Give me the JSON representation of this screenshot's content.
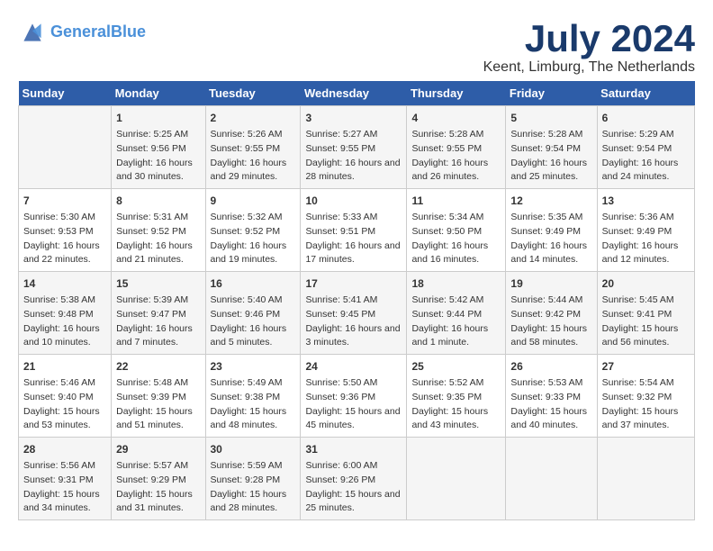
{
  "header": {
    "logo_line1": "General",
    "logo_line2": "Blue",
    "month": "July 2024",
    "location": "Keent, Limburg, The Netherlands"
  },
  "weekdays": [
    "Sunday",
    "Monday",
    "Tuesday",
    "Wednesday",
    "Thursday",
    "Friday",
    "Saturday"
  ],
  "weeks": [
    [
      {
        "day": "",
        "sunrise": "",
        "sunset": "",
        "daylight": ""
      },
      {
        "day": "1",
        "sunrise": "Sunrise: 5:25 AM",
        "sunset": "Sunset: 9:56 PM",
        "daylight": "Daylight: 16 hours and 30 minutes."
      },
      {
        "day": "2",
        "sunrise": "Sunrise: 5:26 AM",
        "sunset": "Sunset: 9:55 PM",
        "daylight": "Daylight: 16 hours and 29 minutes."
      },
      {
        "day": "3",
        "sunrise": "Sunrise: 5:27 AM",
        "sunset": "Sunset: 9:55 PM",
        "daylight": "Daylight: 16 hours and 28 minutes."
      },
      {
        "day": "4",
        "sunrise": "Sunrise: 5:28 AM",
        "sunset": "Sunset: 9:55 PM",
        "daylight": "Daylight: 16 hours and 26 minutes."
      },
      {
        "day": "5",
        "sunrise": "Sunrise: 5:28 AM",
        "sunset": "Sunset: 9:54 PM",
        "daylight": "Daylight: 16 hours and 25 minutes."
      },
      {
        "day": "6",
        "sunrise": "Sunrise: 5:29 AM",
        "sunset": "Sunset: 9:54 PM",
        "daylight": "Daylight: 16 hours and 24 minutes."
      }
    ],
    [
      {
        "day": "7",
        "sunrise": "Sunrise: 5:30 AM",
        "sunset": "Sunset: 9:53 PM",
        "daylight": "Daylight: 16 hours and 22 minutes."
      },
      {
        "day": "8",
        "sunrise": "Sunrise: 5:31 AM",
        "sunset": "Sunset: 9:52 PM",
        "daylight": "Daylight: 16 hours and 21 minutes."
      },
      {
        "day": "9",
        "sunrise": "Sunrise: 5:32 AM",
        "sunset": "Sunset: 9:52 PM",
        "daylight": "Daylight: 16 hours and 19 minutes."
      },
      {
        "day": "10",
        "sunrise": "Sunrise: 5:33 AM",
        "sunset": "Sunset: 9:51 PM",
        "daylight": "Daylight: 16 hours and 17 minutes."
      },
      {
        "day": "11",
        "sunrise": "Sunrise: 5:34 AM",
        "sunset": "Sunset: 9:50 PM",
        "daylight": "Daylight: 16 hours and 16 minutes."
      },
      {
        "day": "12",
        "sunrise": "Sunrise: 5:35 AM",
        "sunset": "Sunset: 9:49 PM",
        "daylight": "Daylight: 16 hours and 14 minutes."
      },
      {
        "day": "13",
        "sunrise": "Sunrise: 5:36 AM",
        "sunset": "Sunset: 9:49 PM",
        "daylight": "Daylight: 16 hours and 12 minutes."
      }
    ],
    [
      {
        "day": "14",
        "sunrise": "Sunrise: 5:38 AM",
        "sunset": "Sunset: 9:48 PM",
        "daylight": "Daylight: 16 hours and 10 minutes."
      },
      {
        "day": "15",
        "sunrise": "Sunrise: 5:39 AM",
        "sunset": "Sunset: 9:47 PM",
        "daylight": "Daylight: 16 hours and 7 minutes."
      },
      {
        "day": "16",
        "sunrise": "Sunrise: 5:40 AM",
        "sunset": "Sunset: 9:46 PM",
        "daylight": "Daylight: 16 hours and 5 minutes."
      },
      {
        "day": "17",
        "sunrise": "Sunrise: 5:41 AM",
        "sunset": "Sunset: 9:45 PM",
        "daylight": "Daylight: 16 hours and 3 minutes."
      },
      {
        "day": "18",
        "sunrise": "Sunrise: 5:42 AM",
        "sunset": "Sunset: 9:44 PM",
        "daylight": "Daylight: 16 hours and 1 minute."
      },
      {
        "day": "19",
        "sunrise": "Sunrise: 5:44 AM",
        "sunset": "Sunset: 9:42 PM",
        "daylight": "Daylight: 15 hours and 58 minutes."
      },
      {
        "day": "20",
        "sunrise": "Sunrise: 5:45 AM",
        "sunset": "Sunset: 9:41 PM",
        "daylight": "Daylight: 15 hours and 56 minutes."
      }
    ],
    [
      {
        "day": "21",
        "sunrise": "Sunrise: 5:46 AM",
        "sunset": "Sunset: 9:40 PM",
        "daylight": "Daylight: 15 hours and 53 minutes."
      },
      {
        "day": "22",
        "sunrise": "Sunrise: 5:48 AM",
        "sunset": "Sunset: 9:39 PM",
        "daylight": "Daylight: 15 hours and 51 minutes."
      },
      {
        "day": "23",
        "sunrise": "Sunrise: 5:49 AM",
        "sunset": "Sunset: 9:38 PM",
        "daylight": "Daylight: 15 hours and 48 minutes."
      },
      {
        "day": "24",
        "sunrise": "Sunrise: 5:50 AM",
        "sunset": "Sunset: 9:36 PM",
        "daylight": "Daylight: 15 hours and 45 minutes."
      },
      {
        "day": "25",
        "sunrise": "Sunrise: 5:52 AM",
        "sunset": "Sunset: 9:35 PM",
        "daylight": "Daylight: 15 hours and 43 minutes."
      },
      {
        "day": "26",
        "sunrise": "Sunrise: 5:53 AM",
        "sunset": "Sunset: 9:33 PM",
        "daylight": "Daylight: 15 hours and 40 minutes."
      },
      {
        "day": "27",
        "sunrise": "Sunrise: 5:54 AM",
        "sunset": "Sunset: 9:32 PM",
        "daylight": "Daylight: 15 hours and 37 minutes."
      }
    ],
    [
      {
        "day": "28",
        "sunrise": "Sunrise: 5:56 AM",
        "sunset": "Sunset: 9:31 PM",
        "daylight": "Daylight: 15 hours and 34 minutes."
      },
      {
        "day": "29",
        "sunrise": "Sunrise: 5:57 AM",
        "sunset": "Sunset: 9:29 PM",
        "daylight": "Daylight: 15 hours and 31 minutes."
      },
      {
        "day": "30",
        "sunrise": "Sunrise: 5:59 AM",
        "sunset": "Sunset: 9:28 PM",
        "daylight": "Daylight: 15 hours and 28 minutes."
      },
      {
        "day": "31",
        "sunrise": "Sunrise: 6:00 AM",
        "sunset": "Sunset: 9:26 PM",
        "daylight": "Daylight: 15 hours and 25 minutes."
      },
      {
        "day": "",
        "sunrise": "",
        "sunset": "",
        "daylight": ""
      },
      {
        "day": "",
        "sunrise": "",
        "sunset": "",
        "daylight": ""
      },
      {
        "day": "",
        "sunrise": "",
        "sunset": "",
        "daylight": ""
      }
    ]
  ]
}
